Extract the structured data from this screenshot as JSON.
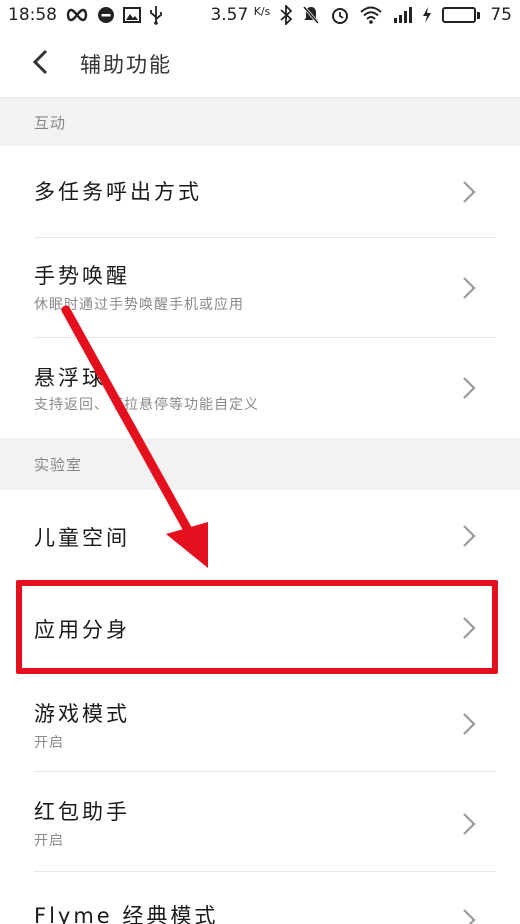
{
  "status_bar": {
    "time": "18:58",
    "speed": "3.57",
    "speed_unit": "K/s",
    "battery_level": "75",
    "battery_fraction": 0.75,
    "icons": [
      "infinity-icon",
      "sync-icon",
      "image-icon",
      "usb-icon",
      "bluetooth-icon",
      "mute-icon",
      "alarm-icon",
      "wifi-icon",
      "signal-4g-icon",
      "charging-icon"
    ],
    "battery_color": "#2ea043"
  },
  "header": {
    "title": "辅助功能",
    "back_icon": "chevron-left-icon"
  },
  "sections": [
    {
      "title": "互动",
      "items": [
        {
          "title": "多任务呼出方式",
          "subtitle": ""
        },
        {
          "title": "手势唤醒",
          "subtitle": "休眠时通过手势唤醒手机或应用"
        },
        {
          "title": "悬浮球",
          "subtitle": "支持返回、下拉悬停等功能自定义"
        }
      ]
    },
    {
      "title": "实验室",
      "items": [
        {
          "title": "儿童空间",
          "subtitle": ""
        },
        {
          "title": "应用分身",
          "subtitle": ""
        },
        {
          "title": "游戏模式",
          "subtitle": "开启"
        },
        {
          "title": "红包助手",
          "subtitle": "开启"
        },
        {
          "title": "Flyme 经典模式",
          "subtitle": ""
        }
      ]
    }
  ],
  "annotation": {
    "color": "#e5101e",
    "highlighted_item": "应用分身"
  }
}
